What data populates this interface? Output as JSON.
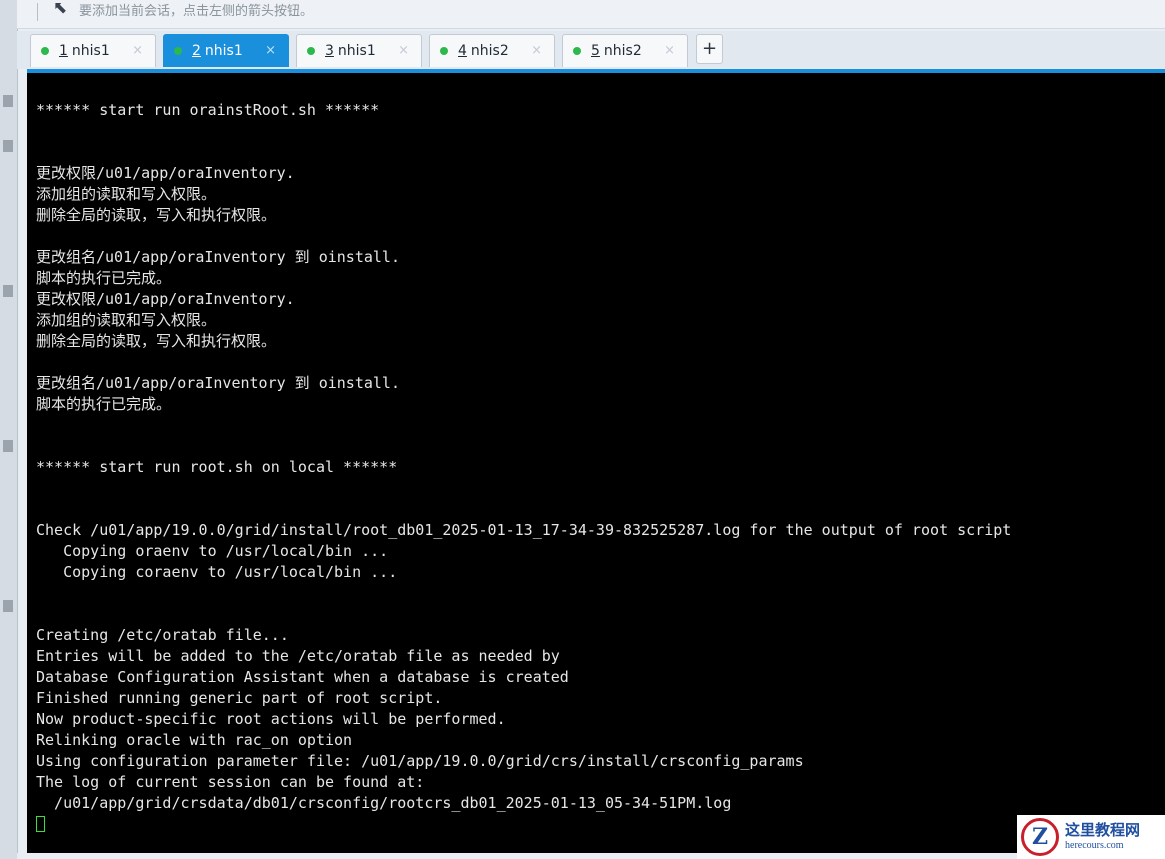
{
  "toolbar": {
    "hint_icon": "arrow-cursor-icon",
    "hint_text": "要添加当前会话，点击左侧的箭头按钮。"
  },
  "tabs": [
    {
      "number": "1",
      "label": "nhis1",
      "status_color": "#2db84d",
      "active": false,
      "close_glyph": "×"
    },
    {
      "number": "2",
      "label": "nhis1",
      "status_color": "#2db84d",
      "active": true,
      "close_glyph": "×"
    },
    {
      "number": "3",
      "label": "nhis1",
      "status_color": "#2db84d",
      "active": false,
      "close_glyph": "×"
    },
    {
      "number": "4",
      "label": "nhis2",
      "status_color": "#2db84d",
      "active": false,
      "close_glyph": "×"
    },
    {
      "number": "5",
      "label": "nhis2",
      "status_color": "#2db84d",
      "active": false,
      "close_glyph": "×"
    }
  ],
  "add_tab_label": "+",
  "terminal": {
    "lines": [
      "****** start run orainstRoot.sh ******",
      "更改权限/u01/app/oraInventory.",
      "添加组的读取和写入权限。",
      "删除全局的读取，写入和执行权限。",
      "更改组名/u01/app/oraInventory 到 oinstall.",
      "脚本的执行已完成。",
      "更改权限/u01/app/oraInventory.",
      "添加组的读取和写入权限。",
      "删除全局的读取，写入和执行权限。",
      "更改组名/u01/app/oraInventory 到 oinstall.",
      "脚本的执行已完成。",
      "****** start run root.sh on local ******",
      "Check /u01/app/19.0.0/grid/install/root_db01_2025-01-13_17-34-39-832525287.log for the output of root script",
      "   Copying oraenv to /usr/local/bin ...",
      "   Copying coraenv to /usr/local/bin ...",
      "Creating /etc/oratab file...",
      "Entries will be added to the /etc/oratab file as needed by",
      "Database Configuration Assistant when a database is created",
      "Finished running generic part of root script.",
      "Now product-specific root actions will be performed.",
      "Relinking oracle with rac_on option",
      "Using configuration parameter file: /u01/app/19.0.0/grid/crs/install/crsconfig_params",
      "The log of current session can be found at:",
      "  /u01/app/grid/crsdata/db01/crsconfig/rootcrs_db01_2025-01-13_05-34-51PM.log"
    ],
    "background": "#000000",
    "text_color": "#e6e6e6",
    "cursor_color": "#3adf3a"
  },
  "watermark": {
    "logo_letter": "Z",
    "title": "这里教程网",
    "url": "herecours.com"
  }
}
